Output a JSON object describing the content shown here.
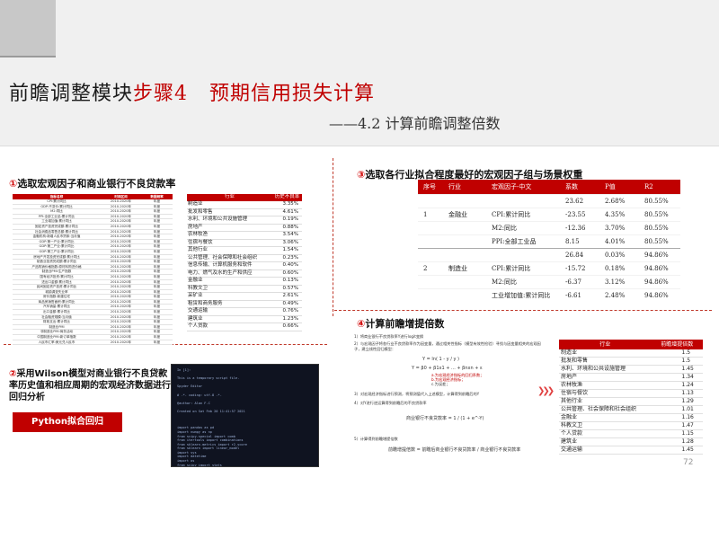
{
  "header": {
    "title_main": "前瞻调整模块",
    "title_step": "步骤4",
    "title_rest": "预期信用损失计算",
    "subtitle": "——4.2 计算前瞻调整倍数"
  },
  "section1": {
    "num": "①",
    "text": "选取宏观因子和商业银行不良贷款率",
    "table1": {
      "headers": [
        "指标名称",
        "时间区间",
        "数据频率"
      ],
      "rows": [
        [
          "CPI:累计同比",
          "2010-2020年",
          "年度"
        ],
        [
          "GDP:不变价:累计同比",
          "2010-2020年",
          "年度"
        ],
        [
          "M2:同比",
          "2010-2020年",
          "年度"
        ],
        [
          "PPI:全部工业品:累计同比",
          "2010-2020年",
          "年度"
        ],
        [
          "工业增加值:累计同比",
          "2010-2020年",
          "年度"
        ],
        [
          "固定资产投资完成额:累计同比",
          "2010-2020年",
          "年度"
        ],
        [
          "社会消费品零售总额:累计同比",
          "2010-2020年",
          "年度"
        ],
        [
          "金融机构:新增人民币贷款:当月值",
          "2010-2020年",
          "年度"
        ],
        [
          "GDP:第一产业:累计同比",
          "2010-2020年",
          "年度"
        ],
        [
          "GDP:第二产业:累计同比",
          "2010-2020年",
          "年度"
        ],
        [
          "GDP:第三产业:累计同比",
          "2010-2020年",
          "年度"
        ],
        [
          "房地产开发投资完成额:累计同比",
          "2010-2020年",
          "年度"
        ],
        [
          "制造业投资完成额:累计同比",
          "2010-2020年",
          "年度"
        ],
        [
          "产品购销价格指数:原材料购进价格",
          "2010-2020年",
          "年度"
        ],
        [
          "制造业PMI:生产指数",
          "2010-2020年",
          "年度"
        ],
        [
          "国有经济投资:累计同比",
          "2010-2020年",
          "年度"
        ],
        [
          "进出口金额:累计同比",
          "2010-2020年",
          "年度"
        ],
        [
          "民间固定资产投资:累计同比",
          "2010-2020年",
          "年度"
        ],
        [
          "城镇调查失业率",
          "2010-2020年",
          "年度"
        ],
        [
          "房价指数:新建住宅",
          "2010-2020年",
          "年度"
        ],
        [
          "商品房销售面积:累计同比",
          "2010-2020年",
          "年度"
        ],
        [
          "汽车销量:累计同比",
          "2010-2020年",
          "年度"
        ],
        [
          "出口金额:累计同比",
          "2010-2020年",
          "年度"
        ],
        [
          "社会融资规模:当月值",
          "2010-2020年",
          "年度"
        ],
        [
          "财政支出:累计同比",
          "2010-2020年",
          "年度"
        ],
        [
          "制造业PMI",
          "2010-2020年",
          "年度"
        ],
        [
          "非制造业PMI:商务活动",
          "2010-2020年",
          "年度"
        ],
        [
          "中国制造业PMI:新订单指数",
          "2010-2020年",
          "年度"
        ],
        [
          "人民币汇率:美元兑人民币",
          "2010-2020年",
          "年度"
        ]
      ]
    },
    "table2": {
      "headers": [
        "行业",
        "历史不良率"
      ],
      "rows": [
        [
          "制造业",
          "3.35%"
        ],
        [
          "批发和零售",
          "4.61%"
        ],
        [
          "水利、环境和公共设施管理",
          "0.19%"
        ],
        [
          "房地产",
          "0.88%"
        ],
        [
          "农林牧渔",
          "3.54%"
        ],
        [
          "住宿与餐饮",
          "3.06%"
        ],
        [
          "其他行业",
          "1.54%"
        ],
        [
          "公共管理、社会保障和社会组织",
          "0.23%"
        ],
        [
          "信息传输、计算机服务和软件",
          "0.40%"
        ],
        [
          "电力、燃气及水的生产和供应",
          "0.60%"
        ],
        [
          "金融业",
          "0.13%"
        ],
        [
          "科教文卫",
          "0.57%"
        ],
        [
          "采矿业",
          "2.61%"
        ],
        [
          "租赁和商务服务",
          "0.49%"
        ],
        [
          "交通运输",
          "0.76%"
        ],
        [
          "建筑业",
          "1.23%"
        ],
        [
          "个人贷款",
          "0.66%"
        ]
      ]
    }
  },
  "section2": {
    "num": "②",
    "text_a": "采用Wilson模型对商业银行不良贷款率历史值和",
    "text_b": "相应周期",
    "text_c": "的宏观经济数据进行回归分析",
    "button": "Python拟合回归",
    "code": "In [1]:\n\nThis is a temporary script file.\n\nSpyder Editor\n\n# -*- coding: utf-8 -*-\n\n@author: Alan F.C\n\nCreated on Sat Feb 20 11:41:57 2021\n\n\n\nimport pandas as pd\nimport numpy as np\nfrom scipy.special import comb\nfrom itertools import combinations\nfrom sklearn.metrics import r2_score\nfrom sklearn import linear_model\nimport sys\nimport datetime\nimport os\nfrom scipy import stats\nfrom statsmodels.stats.outliers_influence import variance_inflation_factor\nfrom sklearn import preprocessing\nimport warnings\nwarnings.filterwarnings(\"ignore\")"
  },
  "section3": {
    "num": "③",
    "text": "选取各行业拟合程度最好的宏观因子组与场景权重",
    "table3": {
      "headers": [
        "序号",
        "行业",
        "宏观因子-中文",
        "系数",
        "P值",
        "R2"
      ],
      "rows": [
        {
          "idx": "",
          "industry": "",
          "factor": "",
          "coef": "23.62",
          "p": "2.68%",
          "r2": "80.55%"
        },
        {
          "idx": "1",
          "industry": "金融业",
          "factor": "CPI:累计同比",
          "coef": "-23.55",
          "p": "4.35%",
          "r2": "80.55%"
        },
        {
          "idx": "",
          "industry": "",
          "factor": "M2:同比",
          "coef": "-12.36",
          "p": "3.70%",
          "r2": "80.55%"
        },
        {
          "idx": "",
          "industry": "",
          "factor": "PPI:全部工业品",
          "coef": "8.15",
          "p": "4.01%",
          "r2": "80.55%"
        },
        {
          "idx": "",
          "industry": "",
          "factor": "",
          "coef": "26.84",
          "p": "0.03%",
          "r2": "94.86%"
        },
        {
          "idx": "2",
          "industry": "制造业",
          "factor": "CPI:累计同比",
          "coef": "-15.72",
          "p": "0.18%",
          "r2": "94.86%"
        },
        {
          "idx": "",
          "industry": "",
          "factor": "M2:同比",
          "coef": "-6.37",
          "p": "3.12%",
          "r2": "94.86%"
        },
        {
          "idx": "",
          "industry": "",
          "factor": "工业增加值:累计同比",
          "coef": "-6.61",
          "p": "2.48%",
          "r2": "94.86%"
        }
      ]
    }
  },
  "section4": {
    "num": "④",
    "text": "计算前瞻增提倍数",
    "formulas": {
      "s1": "1）将商业银行不良贷款率Y进行logit变换",
      "s2": "2）与宏观因子将各行业不良贷款率作为因变量，通过相关性指标（模型有效性检验）寻找与因变量相关的宏观因子，建立线性回归模型：",
      "f1": "Y = ln( 1 - y / y )",
      "f2": "Y = β0 + β1x1 + ... + βnxn + ε",
      "s2b": "a.为宏观经济指标的回归系数；",
      "s2c": "b.为宏观经济指标；",
      "s2d": "c.为误差；",
      "s3": "3）对宏观经济指标进行预测，将预测值代入上述模型，计算得到前瞻后的Y",
      "s4": "4）对Y进行逆运算得到前瞻后的不良贷款率",
      "f3": "商业银行不良贷款率 = 1 / (1 + e^-Y)",
      "f4": "前瞻增提倍数 = 前瞻后商业银行不良贷款率 / 商业银行不良贷款率",
      "s5": "5）计算得到前瞻增提倍数"
    },
    "table4": {
      "headers": [
        "行业",
        "前瞻增提倍数"
      ],
      "rows": [
        [
          "制造业",
          "1.5"
        ],
        [
          "批发和零售",
          "1.5"
        ],
        [
          "水利、环境和公共设施管理",
          "1.45"
        ],
        [
          "房地产",
          "1.34"
        ],
        [
          "农林牧渔",
          "1.24"
        ],
        [
          "住宿与餐饮",
          "1.13"
        ],
        [
          "其他行业",
          "1.29"
        ],
        [
          "公共管理、社会保障和社会组织",
          "1.01"
        ],
        [
          "金融业",
          "1.16"
        ],
        [
          "科教文卫",
          "1.47"
        ],
        [
          "个人贷款",
          "1.15"
        ],
        [
          "建筑业",
          "1.28"
        ],
        [
          "交通运输",
          "1.45"
        ]
      ]
    }
  },
  "page_number": "72",
  "colors": {
    "accent": "#c00000",
    "header_bg": "#f0f0f0"
  }
}
